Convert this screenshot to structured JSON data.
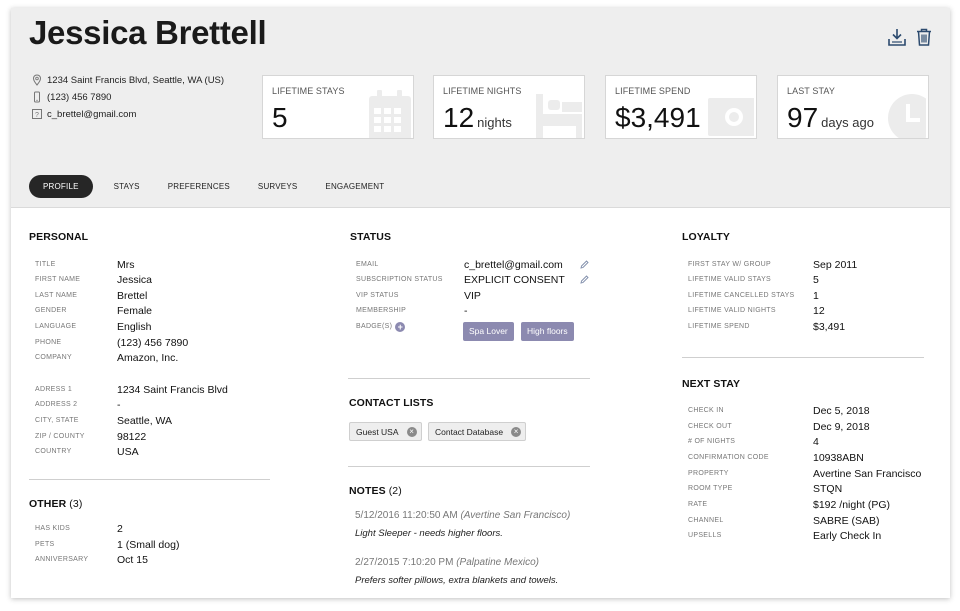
{
  "guest": {
    "name": "Jessica Brettell",
    "address": "1234 Saint Francis Blvd, Seattle, WA (US)",
    "phone": "(123) 456 7890",
    "email": "c_brettel@gmail.com"
  },
  "header_icons": [
    "download-icon",
    "trash-icon"
  ],
  "stats": [
    {
      "label": "LIFETIME STAYS",
      "value": "5",
      "unit": "",
      "icon": "calendar-icon"
    },
    {
      "label": "LIFETIME NIGHTS",
      "value": "12",
      "unit": "nights",
      "icon": "bed-icon"
    },
    {
      "label": "LIFETIME SPEND",
      "value": "$3,491",
      "unit": "",
      "icon": "cash-icon"
    },
    {
      "label": "LAST STAY",
      "value": "97",
      "unit": "days ago",
      "icon": "clock-icon"
    }
  ],
  "tabs": [
    "PROFILE",
    "STAYS",
    "PREFERENCES",
    "SURVEYS",
    "ENGAGEMENT"
  ],
  "active_tab": "PROFILE",
  "personal": {
    "title": "PERSONAL",
    "rows": [
      {
        "k": "TITLE",
        "v": "Mrs"
      },
      {
        "k": "FIRST NAME",
        "v": "Jessica"
      },
      {
        "k": "LAST NAME",
        "v": "Brettel"
      },
      {
        "k": "GENDER",
        "v": "Female"
      },
      {
        "k": "LANGUAGE",
        "v": "English"
      },
      {
        "k": "PHONE",
        "v": "(123) 456 7890"
      },
      {
        "k": "COMPANY",
        "v": "Amazon, Inc."
      }
    ],
    "address_rows": [
      {
        "k": "ADRESS 1",
        "v": "1234 Saint Francis Blvd"
      },
      {
        "k": "ADDRESS 2",
        "v": "-"
      },
      {
        "k": "CITY, STATE",
        "v": "Seattle, WA"
      },
      {
        "k": "ZIP / COUNTY",
        "v": "98122"
      },
      {
        "k": "COUNTRY",
        "v": "USA"
      }
    ]
  },
  "other": {
    "title": "OTHER",
    "count": "(3)",
    "rows": [
      {
        "k": "HAS KIDS",
        "v": "2"
      },
      {
        "k": "PETS",
        "v": "1 (Small dog)"
      },
      {
        "k": "ANNIVERSARY",
        "v": "Oct 15"
      }
    ]
  },
  "status": {
    "title": "STATUS",
    "rows": [
      {
        "k": "EMAIL",
        "v": "c_brettel@gmail.com"
      },
      {
        "k": "SUBSCRIPTION STATUS",
        "v": "EXPLICIT CONSENT"
      },
      {
        "k": "VIP STATUS",
        "v": "VIP"
      },
      {
        "k": "MEMBERSHIP",
        "v": "-"
      }
    ],
    "badges_label": "BADGE(S)",
    "badges": [
      "Spa Lover",
      "High floors"
    ]
  },
  "contact_lists": {
    "title": "CONTACT LISTS",
    "items": [
      "Guest USA",
      "Contact Database"
    ]
  },
  "notes": {
    "title": "NOTES",
    "count": "(2)",
    "items": [
      {
        "datetime": "5/12/2016 11:20:50 AM",
        "location": "(Avertine San Francisco)",
        "text": "Light Sleeper - needs higher floors."
      },
      {
        "datetime": "2/27/2015 7:10:20 PM",
        "location": "(Palpatine Mexico)",
        "text": "Prefers softer pillows, extra blankets and towels."
      }
    ]
  },
  "loyalty": {
    "title": "LOYALTY",
    "rows": [
      {
        "k": "FIRST STAY W/ GROUP",
        "v": "Sep 2011"
      },
      {
        "k": "LIFETIME VALID STAYS",
        "v": "5"
      },
      {
        "k": "LIFETIME CANCELLED STAYS",
        "v": "1"
      },
      {
        "k": "LIFETIME VALID NIGHTS",
        "v": "12"
      },
      {
        "k": "LIFETIME SPEND",
        "v": "$3,491"
      }
    ]
  },
  "next_stay": {
    "title": "NEXT STAY",
    "rows": [
      {
        "k": "CHECK IN",
        "v": "Dec 5, 2018"
      },
      {
        "k": "CHECK OUT",
        "v": "Dec 9, 2018"
      },
      {
        "k": "# OF NIGHTS",
        "v": "4"
      },
      {
        "k": "CONFIRMATION CODE",
        "v": "10938ABN"
      },
      {
        "k": "PROPERTY",
        "v": "Avertine San Francisco"
      },
      {
        "k": "ROOM TYPE",
        "v": "STQN"
      },
      {
        "k": "RATE",
        "v": "$192 /night (PG)"
      },
      {
        "k": "CHANNEL",
        "v": "SABRE (SAB)"
      },
      {
        "k": "UPSELLS",
        "v": "Early Check In"
      }
    ]
  }
}
